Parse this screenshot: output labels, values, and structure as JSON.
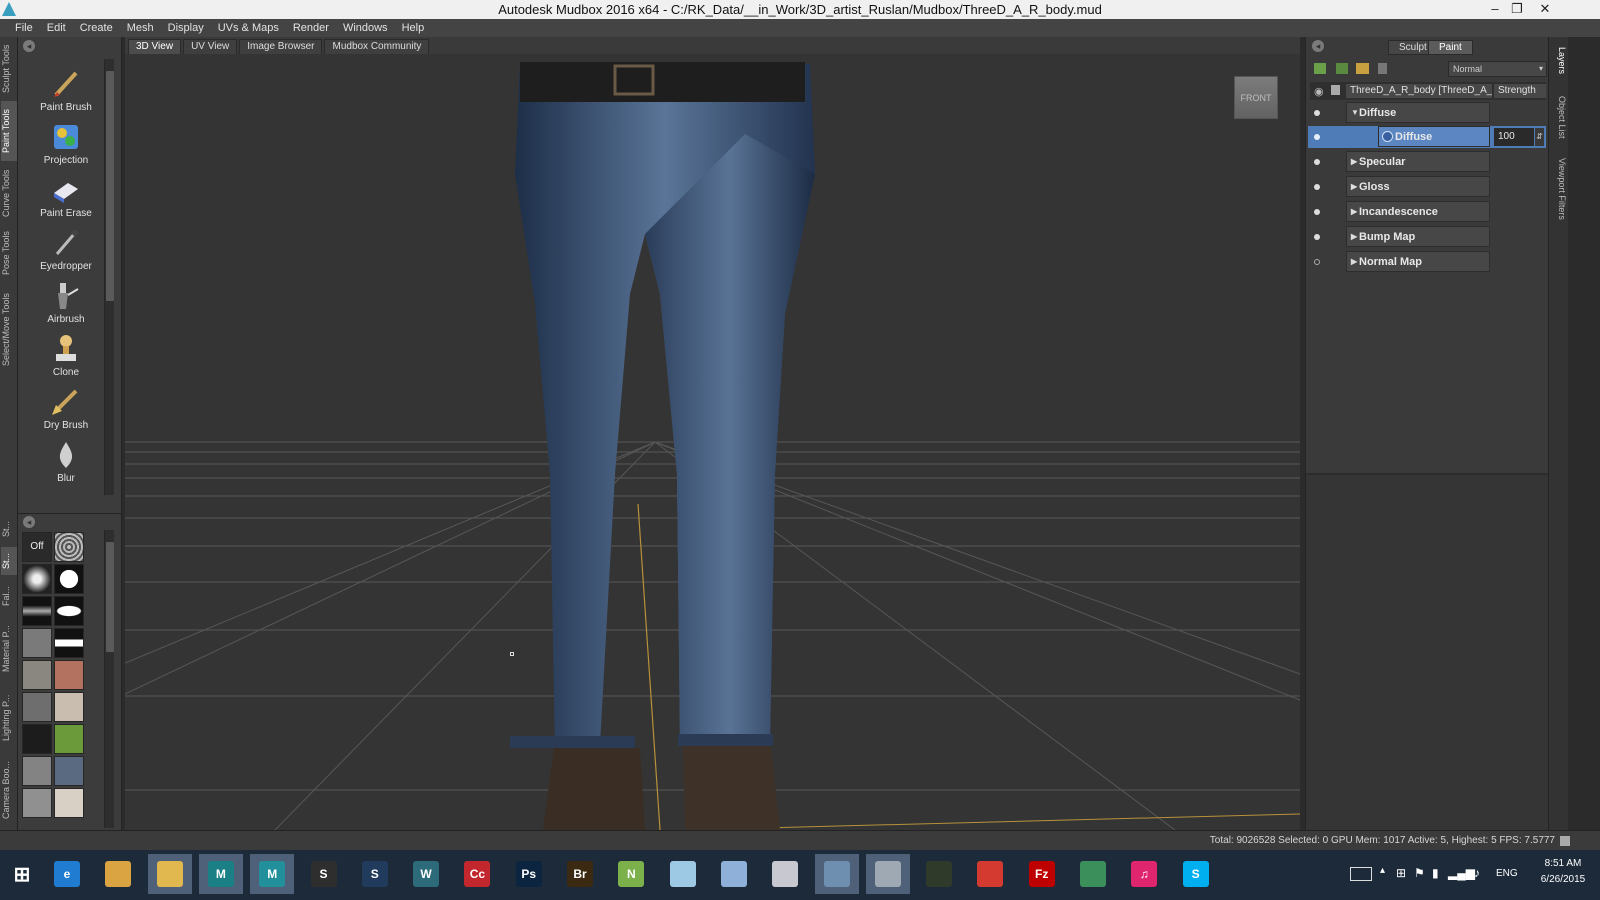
{
  "window": {
    "title": "Autodesk Mudbox 2016 x64 - C:/RK_Data/__in_Work/3D_artist_Ruslan/Mudbox/ThreeD_A_R_body.mud"
  },
  "menu": [
    "File",
    "Edit",
    "Create",
    "Mesh",
    "Display",
    "UVs & Maps",
    "Render",
    "Windows",
    "Help"
  ],
  "left_tabs_top": [
    "Sculpt Tools",
    "Paint Tools",
    "Curve Tools",
    "Pose Tools",
    "Select/Move Tools"
  ],
  "left_tabs_bottom": [
    "St...",
    "St...",
    "Fal...",
    "Material P...",
    "Lighting P...",
    "Camera Boo..."
  ],
  "tools": [
    {
      "label": "Paint Brush",
      "icon": "paint-brush-icon"
    },
    {
      "label": "Projection",
      "icon": "projection-icon"
    },
    {
      "label": "Paint Erase",
      "icon": "eraser-icon"
    },
    {
      "label": "Eyedropper",
      "icon": "eyedropper-icon"
    },
    {
      "label": "Airbrush",
      "icon": "airbrush-icon"
    },
    {
      "label": "Clone",
      "icon": "clone-stamp-icon"
    },
    {
      "label": "Dry Brush",
      "icon": "dry-brush-icon"
    },
    {
      "label": "Blur",
      "icon": "blur-drop-icon"
    }
  ],
  "stamps": {
    "off_label": "Off"
  },
  "view_tabs": [
    {
      "label": "3D View",
      "active": true
    },
    {
      "label": "UV View",
      "active": false
    },
    {
      "label": "Image Browser",
      "active": false
    },
    {
      "label": "Mudbox Community",
      "active": false
    }
  ],
  "viewport": {
    "cube_label": "FRONT",
    "bg_color": "#343434",
    "grid_color": "#5a5a5a",
    "axis_color": "#b8913a"
  },
  "right_panel": {
    "mode_tabs": [
      {
        "label": "Sculpt",
        "active": false
      },
      {
        "label": "Paint",
        "active": true
      }
    ],
    "blend_mode": "Normal",
    "header_object": "ThreeD_A_R_body [ThreeD_A_R_",
    "header_strength": "Strength",
    "layers": [
      {
        "label": "Diffuse",
        "expanded": true,
        "visible": true
      },
      {
        "label": "Diffuse",
        "child": true,
        "strength": "100",
        "selected": true,
        "visible": true
      },
      {
        "label": "Specular",
        "expanded": false,
        "visible": true
      },
      {
        "label": "Gloss",
        "expanded": false,
        "visible": true
      },
      {
        "label": "Incandescence",
        "expanded": false,
        "visible": true
      },
      {
        "label": "Bump Map",
        "expanded": false,
        "visible": true
      },
      {
        "label": "Normal Map",
        "expanded": false,
        "visible": false
      }
    ],
    "vertical_tabs": [
      "Layers",
      "Object List",
      "Viewport Filters"
    ]
  },
  "status": {
    "text": "Total: 9026528  Selected: 0 GPU Mem: 1017  Active: 5, Highest: 5  FPS: 7.5777"
  },
  "taskbar": {
    "apps": [
      {
        "name": "windows-start-icon",
        "glyph": "",
        "color": "#1d2a3a"
      },
      {
        "name": "internet-explorer-icon",
        "glyph": "e",
        "color": "#1f7cd0"
      },
      {
        "name": "file-explorer-icon",
        "glyph": "",
        "color": "#d9a441"
      },
      {
        "name": "folder-icon",
        "glyph": "",
        "color": "#e0b84f"
      },
      {
        "name": "mudbox-lt-icon",
        "glyph": "M",
        "color": "#1b7f86"
      },
      {
        "name": "mudbox-icon",
        "glyph": "M",
        "color": "#21909b"
      },
      {
        "name": "unity-icon",
        "glyph": "S",
        "color": "#2e2e2e"
      },
      {
        "name": "steam-icon",
        "glyph": "S",
        "color": "#213b5c"
      },
      {
        "name": "world-icon",
        "glyph": "W",
        "color": "#2d6a7a"
      },
      {
        "name": "creative-cloud-icon",
        "glyph": "Cc",
        "color": "#c1272d"
      },
      {
        "name": "photoshop-icon",
        "glyph": "Ps",
        "color": "#0b2540"
      },
      {
        "name": "bridge-icon",
        "glyph": "Br",
        "color": "#3b2a11"
      },
      {
        "name": "notepad-plus-icon",
        "glyph": "N",
        "color": "#7bb04b"
      },
      {
        "name": "note-icon",
        "glyph": "",
        "color": "#9ec9e5"
      },
      {
        "name": "calculator-icon",
        "glyph": "",
        "color": "#8fb0d8"
      },
      {
        "name": "paint-icon",
        "glyph": "",
        "color": "#c8c8d0"
      },
      {
        "name": "remote-desktop-icon",
        "glyph": "",
        "color": "#6f8fb0"
      },
      {
        "name": "image-viewer-icon",
        "glyph": "",
        "color": "#9ea9b4"
      },
      {
        "name": "gpu-z-icon",
        "glyph": "",
        "color": "#2f3a2a"
      },
      {
        "name": "arrow-app-icon",
        "glyph": "",
        "color": "#d43a2f"
      },
      {
        "name": "filezilla-icon",
        "glyph": "Fz",
        "color": "#bf0000"
      },
      {
        "name": "globe-icon",
        "glyph": "",
        "color": "#3b8f5b"
      },
      {
        "name": "itunes-icon",
        "glyph": "♫",
        "color": "#e0256f"
      },
      {
        "name": "skype-icon",
        "glyph": "S",
        "color": "#00aff0"
      }
    ],
    "tray": {
      "lang": "ENG",
      "time": "8:51 AM",
      "date": "6/26/2015"
    }
  }
}
